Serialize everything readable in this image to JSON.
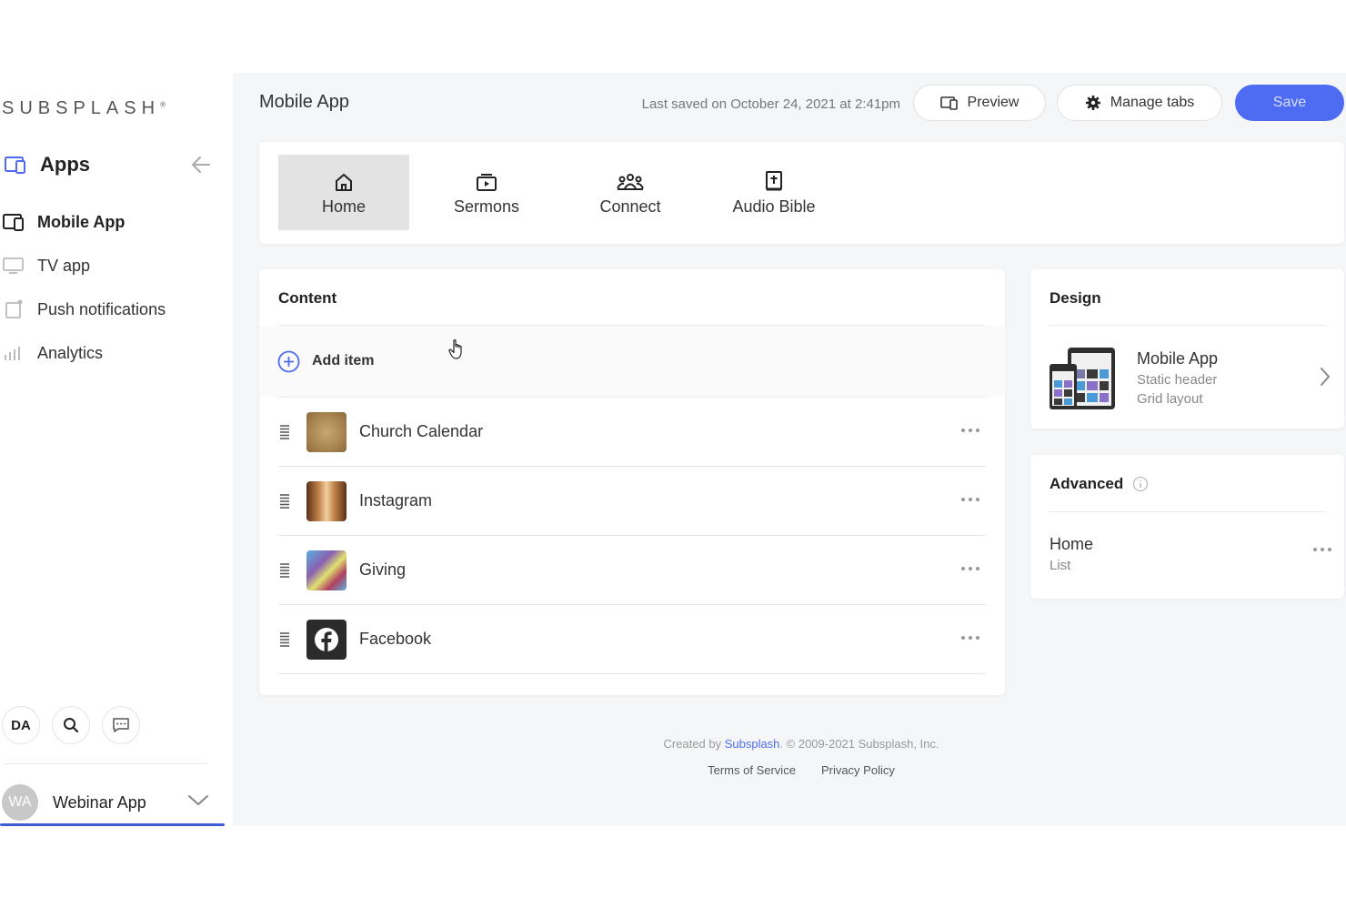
{
  "brand": {
    "logo_text": "SUBSPLASH",
    "trademark": "®",
    "accent": "#4e6cf2"
  },
  "sidebar": {
    "section_title": "Apps",
    "items": [
      {
        "label": "Mobile App",
        "icon": "devices-icon",
        "active": true
      },
      {
        "label": "TV app",
        "icon": "tv-icon",
        "active": false
      },
      {
        "label": "Push notifications",
        "icon": "notification-icon",
        "active": false
      },
      {
        "label": "Analytics",
        "icon": "bar-chart-icon",
        "active": false
      }
    ],
    "initials": "DA",
    "account": {
      "avatar": "WA",
      "name": "Webinar App"
    }
  },
  "header": {
    "title": "Mobile App",
    "last_saved": "Last saved on October 24, 2021 at 2:41pm",
    "preview_label": "Preview",
    "manage_tabs_label": "Manage tabs",
    "save_label": "Save"
  },
  "tabs": [
    {
      "label": "Home",
      "icon": "home-icon",
      "active": true
    },
    {
      "label": "Sermons",
      "icon": "media-icon",
      "active": false
    },
    {
      "label": "Connect",
      "icon": "people-icon",
      "active": false
    },
    {
      "label": "Audio Bible",
      "icon": "bible-icon",
      "active": false
    }
  ],
  "content": {
    "title": "Content",
    "add_item_label": "Add item",
    "items": [
      {
        "name": "Church Calendar"
      },
      {
        "name": "Instagram"
      },
      {
        "name": "Giving"
      },
      {
        "name": "Facebook"
      }
    ]
  },
  "design": {
    "title": "Design",
    "name": "Mobile App",
    "header_type": "Static header",
    "layout": "Grid layout"
  },
  "advanced": {
    "title": "Advanced",
    "name": "Home",
    "type": "List"
  },
  "footer": {
    "created_by": "Created by",
    "company_link": "Subsplash",
    "copyright": ". © 2009-2021 Subsplash, Inc.",
    "terms": "Terms of Service",
    "privacy": "Privacy Policy"
  }
}
